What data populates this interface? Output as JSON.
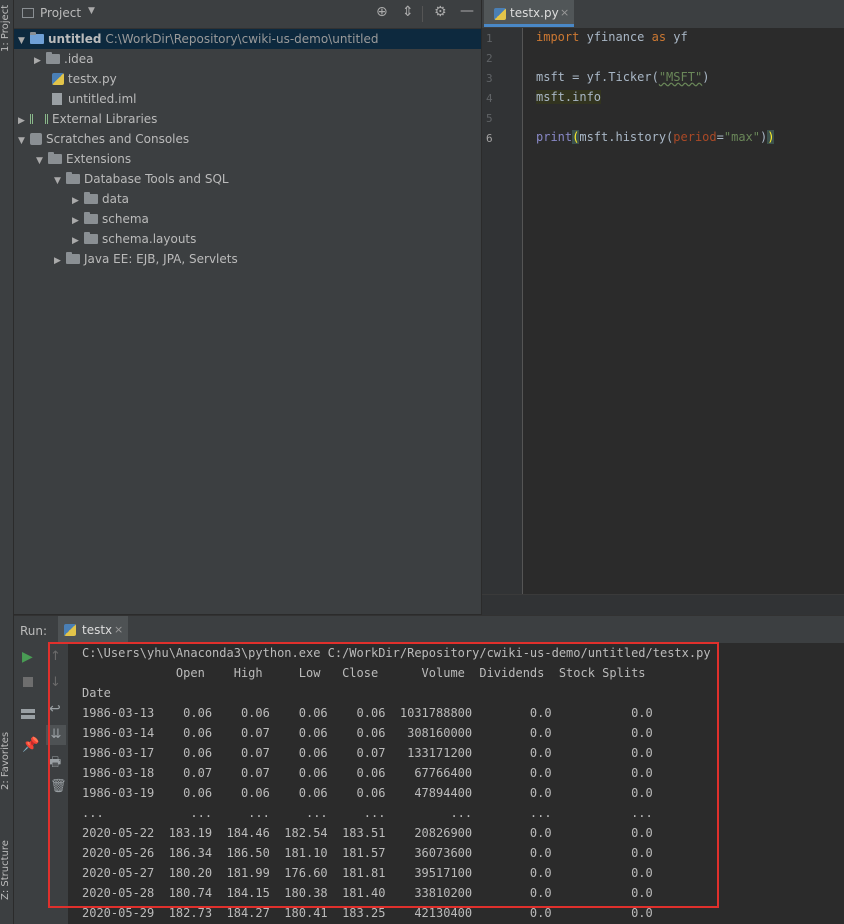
{
  "sidebar": {
    "project_label": "1: Project",
    "favorites_label": "2: Favorites",
    "structure_label": "Z: Structure"
  },
  "project_panel": {
    "title": "Project",
    "tree": [
      {
        "label": "untitled",
        "path": "C:\\WorkDir\\Repository\\cwiki-us-demo\\untitled"
      },
      {
        "label": ".idea"
      },
      {
        "label": "testx.py"
      },
      {
        "label": "untitled.iml"
      },
      {
        "label": "External Libraries"
      },
      {
        "label": "Scratches and Consoles"
      },
      {
        "label": "Extensions"
      },
      {
        "label": "Database Tools and SQL"
      },
      {
        "label": "data"
      },
      {
        "label": "schema"
      },
      {
        "label": "schema.layouts"
      },
      {
        "label": "Java EE: EJB, JPA, Servlets"
      }
    ]
  },
  "editor": {
    "tab_label": "testx.py",
    "line_numbers": [
      "1",
      "2",
      "3",
      "4",
      "5",
      "6"
    ],
    "code": {
      "l1_kw1": "import",
      "l1_mod": " yfinance ",
      "l1_kw2": "as",
      "l1_alias": " yf",
      "l3_a": "msft = yf.Ticker(",
      "l3_str": "\"MSFT\"",
      "l3_b": ")",
      "l4": "msft.info",
      "l6_fn": "print",
      "l6_open": "(",
      "l6_mid": "msft.history(",
      "l6_param": "period",
      "l6_eq": "=",
      "l6_str": "\"max\"",
      "l6_close1": ")",
      "l6_close2": ")"
    }
  },
  "run_panel": {
    "label": "Run:",
    "tab_label": "testx",
    "console_lines": [
      "C:\\Users\\yhu\\Anaconda3\\python.exe C:/WorkDir/Repository/cwiki-us-demo/untitled/testx.py",
      "             Open    High     Low   Close      Volume  Dividends  Stock Splits",
      "Date",
      "1986-03-13    0.06    0.06    0.06    0.06  1031788800        0.0           0.0",
      "1986-03-14    0.06    0.07    0.06    0.06   308160000        0.0           0.0",
      "1986-03-17    0.06    0.07    0.06    0.07   133171200        0.0           0.0",
      "1986-03-18    0.07    0.07    0.06    0.06    67766400        0.0           0.0",
      "1986-03-19    0.06    0.06    0.06    0.06    47894400        0.0           0.0",
      "...            ...     ...     ...     ...         ...        ...           ...",
      "2020-05-22  183.19  184.46  182.54  183.51    20826900        0.0           0.0",
      "2020-05-26  186.34  186.50  181.10  181.57    36073600        0.0           0.0",
      "2020-05-27  180.20  181.99  176.60  181.81    39517100        0.0           0.0",
      "2020-05-28  180.74  184.15  180.38  181.40    33810200        0.0           0.0",
      "2020-05-29  182.73  184.27  180.41  183.25    42130400        0.0           0.0"
    ]
  },
  "colors": {
    "highlight_border": "#e0302c",
    "run_green": "#499c54"
  }
}
